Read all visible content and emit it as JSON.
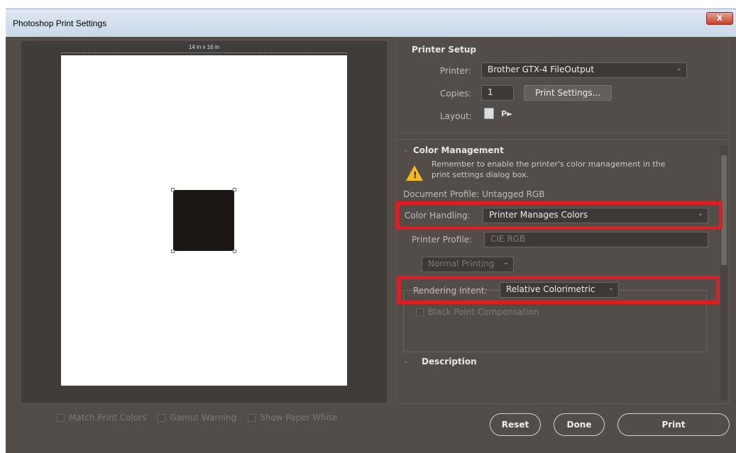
{
  "window": {
    "title": "Photoshop Print Settings",
    "close_glyph": "x"
  },
  "preview": {
    "paper_size": "14 in x 16 in"
  },
  "options": {
    "match_print_colors": "Match Print Colors",
    "gamut_warning": "Gamut Warning",
    "show_paper_white": "Show Paper White"
  },
  "printer_setup": {
    "title": "Printer Setup",
    "printer_label": "Printer:",
    "printer_value": "Brother GTX-4 FileOutput",
    "copies_label": "Copies:",
    "copies_value": "1",
    "print_settings_button": "Print Settings...",
    "layout_label": "Layout:"
  },
  "color_management": {
    "title": "Color Management",
    "warning": "Remember to enable the printer's color management in the print settings dialog box.",
    "document_profile": "Document Profile: Untagged RGB",
    "color_handling_label": "Color Handling:",
    "color_handling_value": "Printer Manages Colors",
    "printer_profile_label": "Printer Profile:",
    "printer_profile_value": "CIE RGB",
    "normal_printing": "Normal Printing",
    "rendering_intent_label": "Rendering Intent:",
    "rendering_intent_value": "Relative Colorimetric",
    "black_point": "Black Point Compensation"
  },
  "description": {
    "title": "Description"
  },
  "buttons": {
    "reset": "Reset",
    "done": "Done",
    "print": "Print"
  },
  "colors": {
    "dialog_bg": "#524d49",
    "highlight": "#e21c21",
    "warning": "#f3b81c"
  }
}
